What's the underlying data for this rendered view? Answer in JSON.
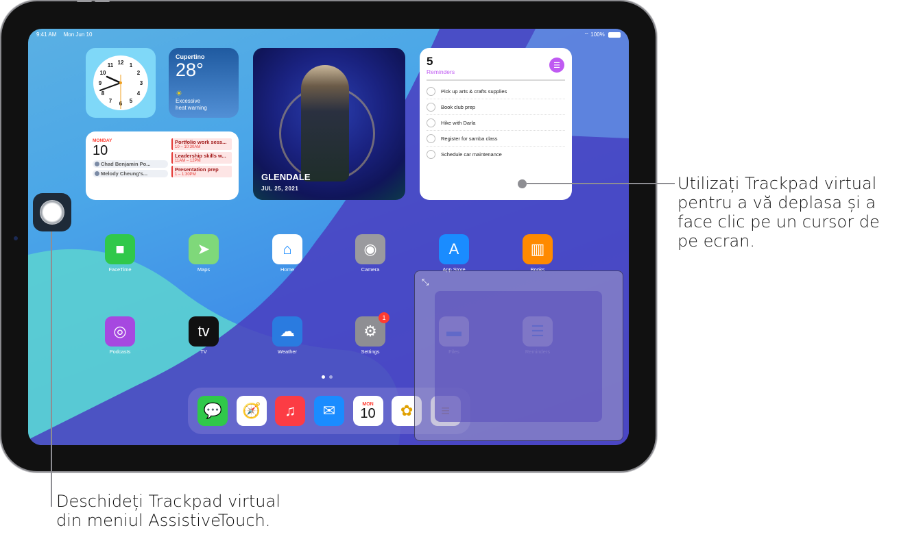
{
  "status_bar": {
    "time": "9:41 AM",
    "date": "Mon Jun 10",
    "battery": "100%"
  },
  "widgets": {
    "clock": {
      "numbers": [
        "12",
        "1",
        "2",
        "3",
        "4",
        "5",
        "6",
        "7",
        "8",
        "9",
        "10",
        "11"
      ]
    },
    "weather": {
      "city": "Cupertino",
      "temperature": "28°",
      "condition_line1": "Excessive",
      "condition_line2": "heat warning",
      "icon": "sun-icon"
    },
    "calendar": {
      "weekday": "MONDAY",
      "day": "10",
      "birthdays": [
        "Chad Benjamin Po...",
        "Melody Cheung's..."
      ],
      "events": [
        {
          "title": "Portfolio work sess...",
          "time": "10 – 10:30AM"
        },
        {
          "title": "Leadership skills w...",
          "time": "11AM – 12PM"
        },
        {
          "title": "Presentation prep",
          "time": "1 – 1:30PM"
        }
      ]
    },
    "photo": {
      "place": "GLENDALE",
      "date": "JUL 25, 2021"
    },
    "reminders": {
      "count": "5",
      "title": "Reminders",
      "items": [
        "Pick up arts & crafts supplies",
        "Book club prep",
        "Hike with Darla",
        "Register for samba class",
        "Schedule car maintenance"
      ]
    }
  },
  "apps": {
    "row1": [
      {
        "label": "FaceTime",
        "icon": "facetime-icon",
        "color": "#30c84a",
        "glyph": "■"
      },
      {
        "label": "Maps",
        "icon": "maps-icon",
        "color": "#7fd87a",
        "glyph": "➤"
      },
      {
        "label": "Home",
        "icon": "home-icon",
        "color": "#ffffff",
        "glyph": "⌂"
      },
      {
        "label": "Camera",
        "icon": "camera-icon",
        "color": "#9a9a9e",
        "glyph": "◉"
      },
      {
        "label": "App Store",
        "icon": "app-store-icon",
        "color": "#1a8cff",
        "glyph": "A"
      },
      {
        "label": "Books",
        "icon": "books-icon",
        "color": "#ff8a00",
        "glyph": "▥"
      }
    ],
    "row2": [
      {
        "label": "Podcasts",
        "icon": "podcasts-icon",
        "color": "#a648e0",
        "glyph": "◎"
      },
      {
        "label": "TV",
        "icon": "tv-icon",
        "color": "#111111",
        "glyph": "tv"
      },
      {
        "label": "Weather",
        "icon": "weather-icon",
        "color": "#2a7be0",
        "glyph": "☁"
      },
      {
        "label": "Settings",
        "icon": "settings-icon",
        "color": "#8e8e93",
        "glyph": "⚙",
        "badge": "1"
      },
      {
        "label": "Files",
        "icon": "files-icon",
        "color": "#f2f2f2",
        "glyph": "▬"
      },
      {
        "label": "Reminders",
        "icon": "reminders-icon",
        "color": "#f2f2f2",
        "glyph": "☰"
      }
    ]
  },
  "dock": [
    {
      "name": "Messages",
      "icon": "messages-icon",
      "color": "#30c84a",
      "glyph": "💬"
    },
    {
      "name": "Safari",
      "icon": "safari-icon",
      "color": "#ffffff",
      "glyph": "🧭"
    },
    {
      "name": "Music",
      "icon": "music-icon",
      "color": "#fc3c44",
      "glyph": "♫"
    },
    {
      "name": "Mail",
      "icon": "mail-icon",
      "color": "#1a8cff",
      "glyph": "✉"
    },
    {
      "name": "Calendar",
      "icon": "calendar-icon",
      "color": "#ffffff",
      "glyph": "10",
      "sub": "MON"
    },
    {
      "name": "Photos",
      "icon": "photos-icon",
      "color": "#ffffff",
      "glyph": "✿"
    },
    {
      "name": "Notes",
      "icon": "notes-icon",
      "color": "#f5f5f5",
      "glyph": "≡"
    }
  ],
  "page_indicator": {
    "pages": 2,
    "current": 1
  },
  "callouts": {
    "right": [
      "Utilizați Trackpad virtual",
      "pentru a vă deplasa și a",
      "face clic pe un cursor de",
      "pe ecran."
    ],
    "bottom": [
      "Deschideți Trackpad virtual",
      "din meniul AssistiveTouch."
    ]
  }
}
